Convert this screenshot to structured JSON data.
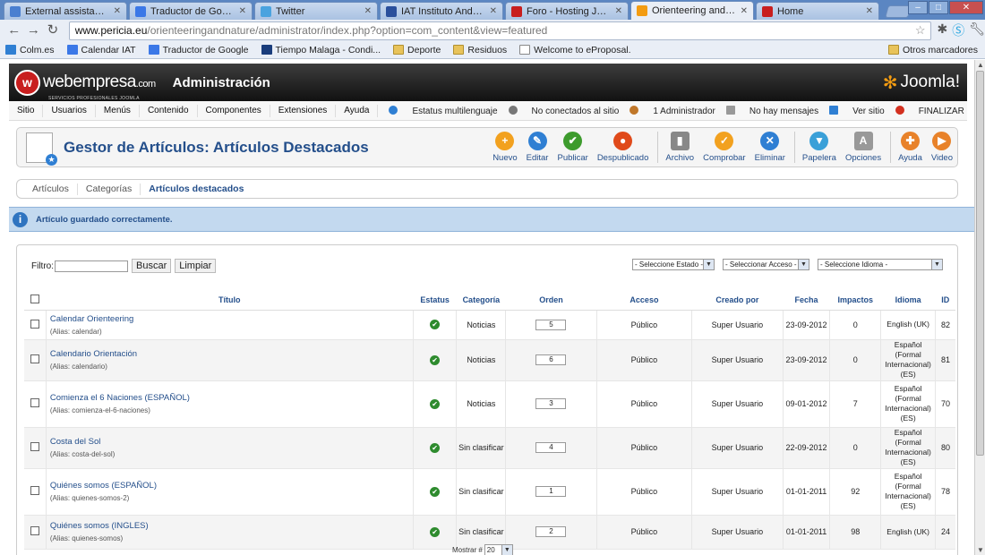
{
  "browser": {
    "tabs": [
      {
        "title": "External assistance costs",
        "color": "#4a7fd0"
      },
      {
        "title": "Traductor de Google",
        "color": "#3b78e7"
      },
      {
        "title": "Twitter",
        "color": "#4aa3df"
      },
      {
        "title": "IAT Instituto Andaluz de T",
        "color": "#2a4f9c"
      },
      {
        "title": "Foro - Hosting Joomla",
        "color": "#c81e1e"
      },
      {
        "title": "Orienteering and Nature",
        "color": "#f39c12"
      },
      {
        "title": "Home",
        "color": "#c81e1e"
      }
    ],
    "url_host": "www.pericia.eu",
    "url_path": "/orienteeringandnature/administrator/index.php?option=com_content&view=featured",
    "bookmarks": [
      "Colm.es",
      "Calendar IAT",
      "Traductor de Google",
      "Tiempo Malaga - Condi...",
      "Deporte",
      "Residuos",
      "Welcome to eProposal."
    ],
    "other_bookmarks": "Otros marcadores"
  },
  "header": {
    "brand": "webempresa",
    "brand_tld": ".com",
    "brand_sub": "SERVICIOS PROFESIONALES JOOMLA",
    "title": "Administración",
    "cms_logo": "Joomla!"
  },
  "menu": [
    "Sitio",
    "Usuarios",
    "Menús",
    "Contenido",
    "Componentes",
    "Extensiones",
    "Ayuda"
  ],
  "status": {
    "multilang": "Estatus multilenguaje",
    "site": "No conectados al sitio",
    "admin": "1 Administrador",
    "messages": "No hay mensajes",
    "view": "Ver sitio",
    "logout": "FINALIZAR"
  },
  "page_title": "Gestor de Artículos: Artículos Destacados",
  "toolbar": [
    {
      "label": "Nuevo",
      "icon": "plus-icon",
      "color": "#f2a11f",
      "glyph": "+"
    },
    {
      "label": "Editar",
      "icon": "pencil-icon",
      "color": "#2f7fd3",
      "glyph": "✎"
    },
    {
      "label": "Publicar",
      "icon": "check-icon",
      "color": "#3d9b2d",
      "glyph": "✔"
    },
    {
      "label": "Despublicado",
      "icon": "unpublish-icon",
      "color": "#e04a1a",
      "glyph": "●"
    },
    {
      "label": "Archivo",
      "icon": "archive-icon",
      "color": "#888888",
      "glyph": "▮"
    },
    {
      "label": "Comprobar",
      "icon": "checkin-icon",
      "color": "#f2a11f",
      "glyph": "✓"
    },
    {
      "label": "Eliminar",
      "icon": "delete-icon",
      "color": "#2f7fd3",
      "glyph": "✕"
    },
    {
      "label": "Papelera",
      "icon": "trash-icon",
      "color": "#3aa0d8",
      "glyph": "▼"
    },
    {
      "label": "Opciones",
      "icon": "options-icon",
      "color": "#999999",
      "glyph": "A"
    },
    {
      "label": "Ayuda",
      "icon": "help-icon",
      "color": "#e8822a",
      "glyph": "✚"
    },
    {
      "label": "Video",
      "icon": "video-icon",
      "color": "#e8822a",
      "glyph": "▶"
    }
  ],
  "subnav": [
    "Artículos",
    "Categorías",
    "Artículos destacados"
  ],
  "message": "Artículo guardado correctamente.",
  "filter": {
    "label": "Filtro:",
    "search_btn": "Buscar",
    "clear_btn": "Limpiar",
    "state": "- Seleccione Estado -",
    "access": "- Seleccionar Acceso -",
    "language": "- Seleccione Idioma -"
  },
  "table": {
    "headers": [
      "Título",
      "Estatus",
      "Categoría",
      "Orden",
      "Acceso",
      "Creado por",
      "Fecha",
      "Impactos",
      "Idioma",
      "ID"
    ],
    "alias_prefix": "(Alias: ",
    "rows": [
      {
        "title": "Calendar Orienteering",
        "alias": "calendar",
        "category": "Noticias",
        "order": "5",
        "access": "Público",
        "author": "Super Usuario",
        "date": "23-09-2012",
        "hits": "0",
        "lang": "English (UK)",
        "id": "82"
      },
      {
        "title": "Calendario Orientación",
        "alias": "calendario",
        "category": "Noticias",
        "order": "6",
        "access": "Público",
        "author": "Super Usuario",
        "date": "23-09-2012",
        "hits": "0",
        "lang": "Español (Formal Internacional) (ES)",
        "id": "81"
      },
      {
        "title": "Comienza el 6 Naciones (ESPAÑOL)",
        "alias": "comienza-el-6-naciones",
        "category": "Noticias",
        "order": "3",
        "access": "Público",
        "author": "Super Usuario",
        "date": "09-01-2012",
        "hits": "7",
        "lang": "Español (Formal Internacional) (ES)",
        "id": "70"
      },
      {
        "title": "Costa del Sol",
        "alias": "costa-del-sol",
        "category": "Sin clasificar",
        "order": "4",
        "access": "Público",
        "author": "Super Usuario",
        "date": "22-09-2012",
        "hits": "0",
        "lang": "Español (Formal Internacional) (ES)",
        "id": "80"
      },
      {
        "title": "Quiénes somos (ESPAÑOL)",
        "alias": "quienes-somos-2",
        "category": "Sin clasificar",
        "order": "1",
        "access": "Público",
        "author": "Super Usuario",
        "date": "01-01-2011",
        "hits": "92",
        "lang": "Español (Formal Internacional) (ES)",
        "id": "78"
      },
      {
        "title": "Quiénes somos (INGLES)",
        "alias": "quienes-somos",
        "category": "Sin clasificar",
        "order": "2",
        "access": "Público",
        "author": "Super Usuario",
        "date": "01-01-2011",
        "hits": "98",
        "lang": "English (UK)",
        "id": "24"
      }
    ]
  },
  "pager": {
    "label": "Mostrar #",
    "value": "20"
  }
}
